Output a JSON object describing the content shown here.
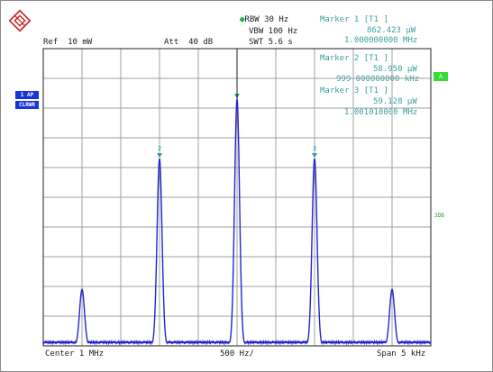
{
  "header": {
    "rbw": "RBW 30 Hz",
    "vbw": "VBW 100 Hz",
    "swt": "SWT 5.6 s",
    "ref": "Ref  10 mW",
    "att": "Att  40 dB"
  },
  "markers": [
    {
      "title": "Marker 1 [T1 ]",
      "level": "862.423 µW",
      "freq": "1.000000000 MHz"
    },
    {
      "title": "Marker 2 [T1 ]",
      "level": "58.950 µW",
      "freq": "999.000000000 kHz"
    },
    {
      "title": "Marker 3 [T1 ]",
      "level": "59.128 µW",
      "freq": "1.001010000 MHz"
    }
  ],
  "side": {
    "trace_badge_1": "1 AP",
    "trace_badge_2": "CLRWR",
    "a_box": "A",
    "right_label": "3DB"
  },
  "footer": {
    "center": "Center 1 MHz",
    "div": "500 Hz/",
    "span": "Span 5 kHz"
  },
  "colors": {
    "trace": "#2424d0",
    "grid": "#a0a0a0",
    "marker": "#2a9a9a",
    "accent_green": "#33dd33",
    "badge_blue": "#1836d8"
  },
  "chart_data": {
    "type": "line",
    "xlabel": "",
    "ylabel": "",
    "x_range_khz": [
      997.5,
      1002.5
    ],
    "y_scale": "linear power, 0 at bottom, 10 divisions",
    "grid": true,
    "peaks": [
      {
        "freq_khz": 998.0,
        "level_div": 1.9
      },
      {
        "freq_khz": 999.0,
        "level_div": 6.3
      },
      {
        "freq_khz": 1000.0,
        "level_div": 8.3
      },
      {
        "freq_khz": 1001.0,
        "level_div": 6.3
      },
      {
        "freq_khz": 1002.0,
        "level_div": 1.9
      }
    ],
    "markers": [
      {
        "label": "1",
        "freq_khz": 1000.0
      },
      {
        "label": "2",
        "freq_khz": 999.0
      },
      {
        "label": "3",
        "freq_khz": 1001.0
      }
    ]
  }
}
